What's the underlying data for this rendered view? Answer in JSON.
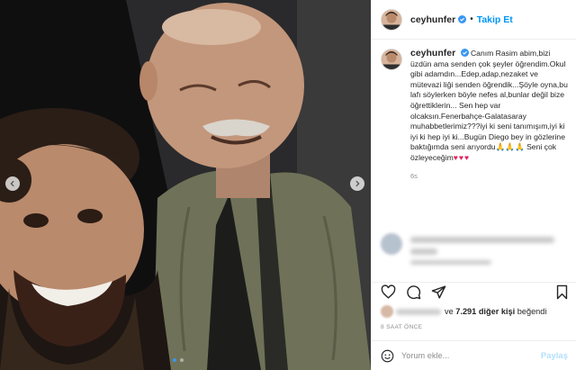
{
  "post": {
    "username": "ceyhunfer",
    "follow_label": "Takip Et",
    "separator": "•",
    "caption": "Canım Rasim abim,bizi üzdün ama senden çok şeyler öğrendim.Okul gibi adamdın...Edep,adap,nezaket ve mütevazi liği senden öğrendik...Şöyle oyna,bu lafı söylerken böyle nefes al,bunlar değil bize öğrettiklerin... Sen hep var olcaksın.Fenerbahçe-Galatasaray muhabbetlerimiz???iyi ki seni tanımışım,iyi ki iyi ki hep iyi ki...Bugün Diego bey in gözlerine baktığımda seni arıyordu🙏🙏🙏 Seni çok özleyeceğim",
    "caption_hearts": "♥♥♥",
    "caption_time": "6s"
  },
  "engagement": {
    "likes_and": "ve",
    "likes_count_text": "7.291 diğer kişi",
    "likes_suffix": "beğendi",
    "posted_ago": "8 SAAT ÖNCE"
  },
  "comment_box": {
    "placeholder": "Yorum ekle...",
    "share_label": "Paylaş"
  },
  "carousel": {
    "slide_count": 2,
    "active_index": 0
  },
  "icons": {
    "header_avatar": "avatar",
    "verified": "verified-badge-icon",
    "like": "heart-icon",
    "comment": "comment-icon",
    "share": "paper-plane-icon",
    "save": "bookmark-icon",
    "emoji": "smiley-icon",
    "prev": "chevron-left-icon",
    "next": "chevron-right-icon"
  },
  "colors": {
    "link_blue": "#0095f6",
    "verified_blue": "#3897f0",
    "heart_red": "#e0245e",
    "muted_gray": "#8e8e8e"
  }
}
